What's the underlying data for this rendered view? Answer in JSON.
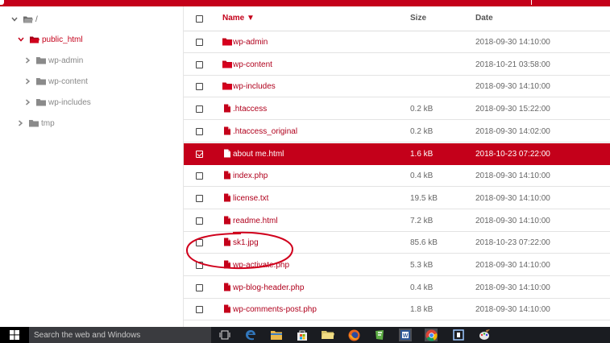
{
  "tree": {
    "root": "/",
    "public_html": "public_html",
    "wp_admin": "wp-admin",
    "wp_content": "wp-content",
    "wp_includes": "wp-includes",
    "tmp": "tmp"
  },
  "table": {
    "col_name": "Name ▼",
    "col_size": "Size",
    "col_date": "Date",
    "rows": [
      {
        "type": "folder",
        "name": "wp-admin",
        "size": "",
        "date": "2018-09-30 14:10:00",
        "selected": false
      },
      {
        "type": "folder",
        "name": "wp-content",
        "size": "",
        "date": "2018-10-21 03:58:00",
        "selected": false
      },
      {
        "type": "folder",
        "name": "wp-includes",
        "size": "",
        "date": "2018-09-30 14:10:00",
        "selected": false
      },
      {
        "type": "file",
        "name": ".htaccess",
        "size": "0.2 kB",
        "date": "2018-09-30 15:22:00",
        "selected": false
      },
      {
        "type": "file",
        "name": ".htaccess_original",
        "size": "0.2 kB",
        "date": "2018-09-30 14:02:00",
        "selected": false
      },
      {
        "type": "file",
        "name": "about me.html",
        "size": "1.6 kB",
        "date": "2018-10-23 07:22:00",
        "selected": true
      },
      {
        "type": "file",
        "name": "index.php",
        "size": "0.4 kB",
        "date": "2018-09-30 14:10:00",
        "selected": false
      },
      {
        "type": "file",
        "name": "license.txt",
        "size": "19.5 kB",
        "date": "2018-09-30 14:10:00",
        "selected": false
      },
      {
        "type": "file",
        "name": "readme.html",
        "size": "7.2 kB",
        "date": "2018-09-30 14:10:00",
        "selected": false
      },
      {
        "type": "file",
        "name": "sk1.jpg",
        "size": "85.6 kB",
        "date": "2018-10-23 07:22:00",
        "selected": false
      },
      {
        "type": "file",
        "name": "wp-activate.php",
        "size": "5.3 kB",
        "date": "2018-09-30 14:10:00",
        "selected": false
      },
      {
        "type": "file",
        "name": "wp-blog-header.php",
        "size": "0.4 kB",
        "date": "2018-09-30 14:10:00",
        "selected": false
      },
      {
        "type": "file",
        "name": "wp-comments-post.php",
        "size": "1.8 kB",
        "date": "2018-09-30 14:10:00",
        "selected": false
      }
    ]
  },
  "taskbar": {
    "search_placeholder": "Search the web and Windows",
    "icons": [
      "task-view-icon",
      "edge-icon",
      "file-explorer-icon",
      "store-icon",
      "folder-icon",
      "firefox-icon",
      "foxit-icon",
      "word-icon",
      "chrome-icon",
      "network-icon",
      "paint-icon"
    ]
  },
  "colors": {
    "accent": "#c4001a",
    "selected_row": "#c4001a",
    "link_text": "#b0001c",
    "taskbar": "#1a1c21",
    "annotation": "#d0001c"
  }
}
